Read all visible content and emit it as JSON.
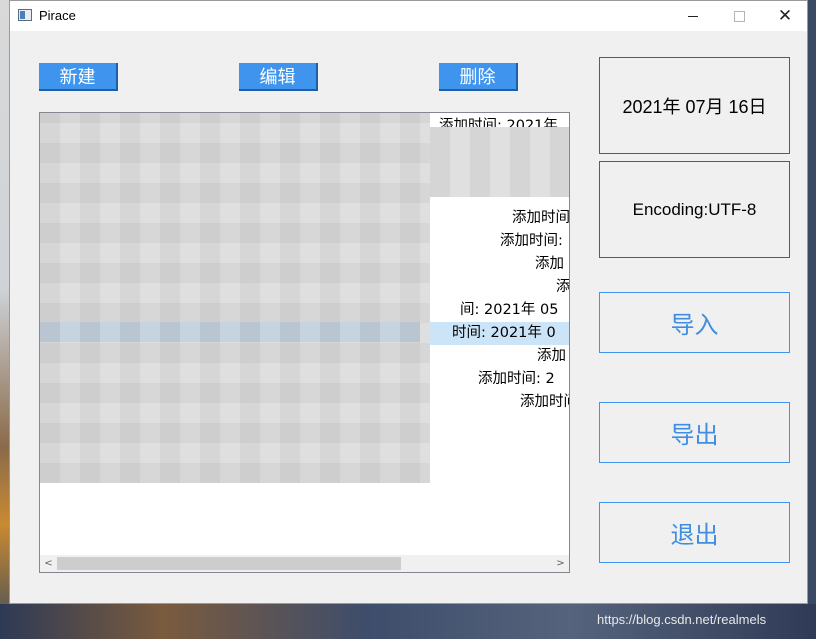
{
  "window": {
    "title": "Pirace",
    "close_glyph": "✕"
  },
  "toolbar": {
    "new_label": "新建",
    "edit_label": "编辑",
    "delete_label": "删除"
  },
  "list": {
    "rows": [
      {
        "text": "添加时间: 2021年"
      },
      {
        "text": "添加时间"
      },
      {
        "text": "添加时间:"
      },
      {
        "text": "添加"
      },
      {
        "text": "添"
      },
      {
        "text": "间: 2021年 05"
      },
      {
        "text": "时间: 2021年 0"
      },
      {
        "text": "添加"
      },
      {
        "text": "添加时间: 2"
      },
      {
        "text": "添加时间"
      }
    ],
    "scroll_left": "<",
    "scroll_right": ">"
  },
  "info": {
    "date": "2021年 07月 16日",
    "encoding": "Encoding:UTF-8"
  },
  "actions": {
    "import_label": "导入",
    "export_label": "导出",
    "exit_label": "退出"
  },
  "watermark": "https://blog.csdn.net/realmels",
  "colors": {
    "accent_blue": "#3f95ee",
    "info_border_red": "#d32626"
  }
}
